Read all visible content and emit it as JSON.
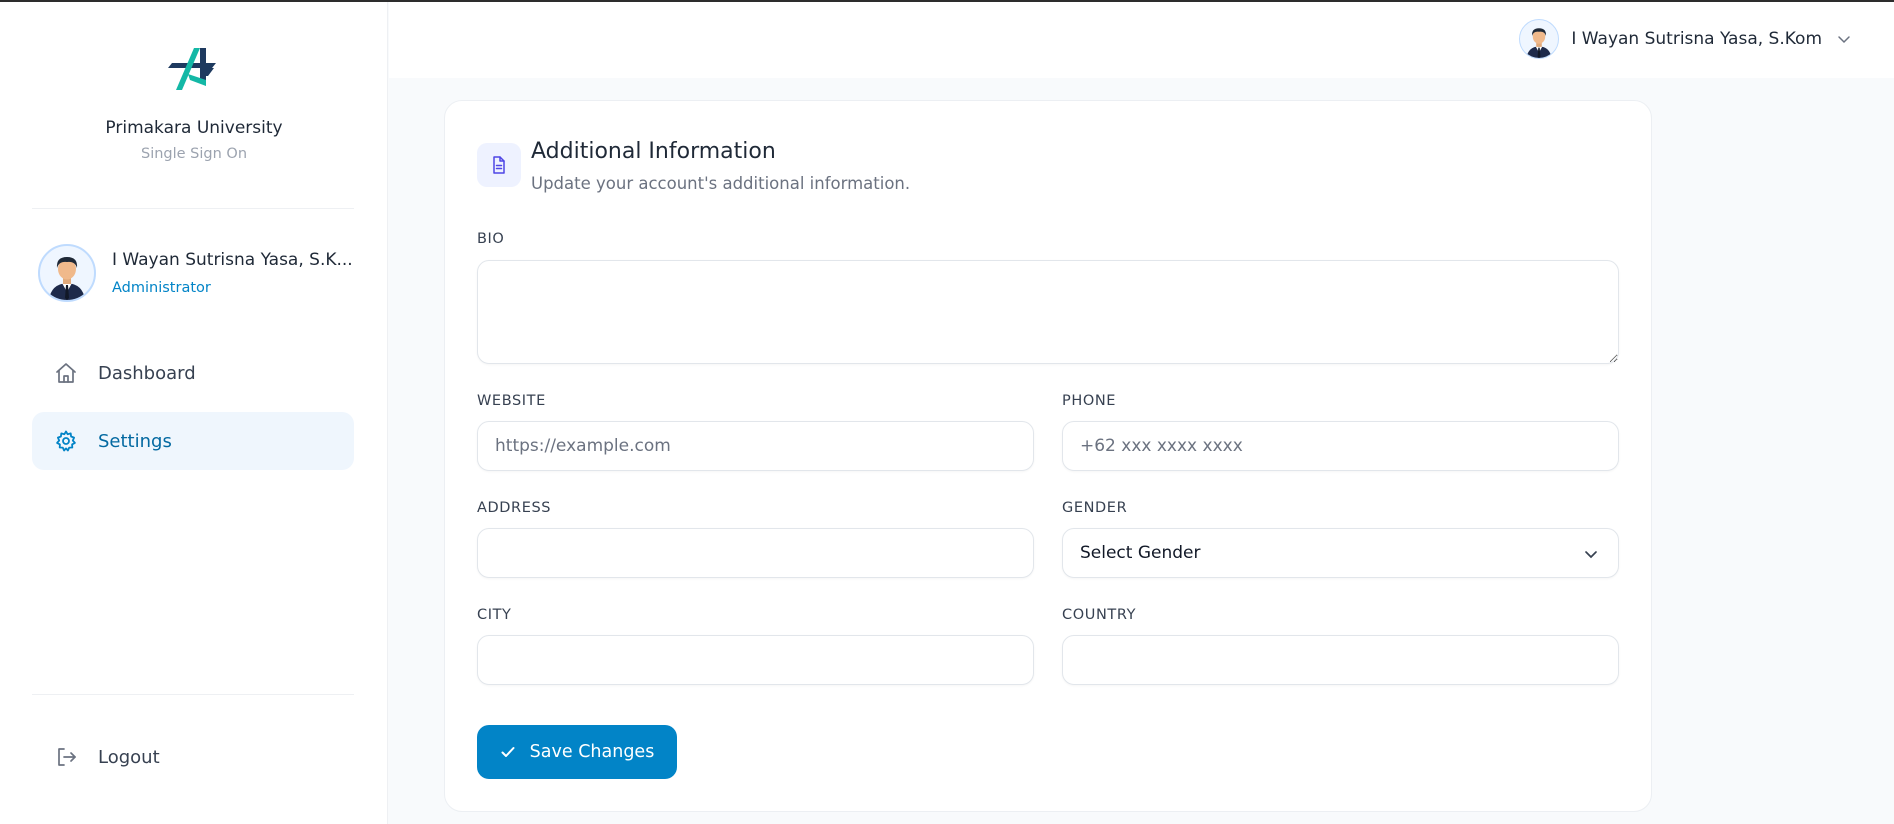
{
  "brand": {
    "name": "Primakara University",
    "subtitle": "Single Sign On"
  },
  "sidebar": {
    "user": {
      "name": "I Wayan Sutrisna Yasa, S.K...",
      "role": "Administrator"
    },
    "nav": [
      {
        "label": "Dashboard",
        "icon": "home-icon",
        "active": false
      },
      {
        "label": "Settings",
        "icon": "gear-icon",
        "active": true
      }
    ],
    "logout_label": "Logout"
  },
  "header": {
    "user_name": "I Wayan Sutrisna Yasa, S.Kom"
  },
  "form": {
    "title": "Additional Information",
    "subtitle": "Update your account's additional information.",
    "bio": {
      "label": "BIO",
      "value": "",
      "placeholder": ""
    },
    "website": {
      "label": "WEBSITE",
      "value": "",
      "placeholder": "https://example.com"
    },
    "phone": {
      "label": "PHONE",
      "value": "",
      "placeholder": "+62 xxx xxxx xxxx"
    },
    "address": {
      "label": "ADDRESS",
      "value": "",
      "placeholder": ""
    },
    "gender": {
      "label": "GENDER",
      "selected": "Select Gender"
    },
    "city": {
      "label": "CITY",
      "value": "",
      "placeholder": ""
    },
    "country": {
      "label": "COUNTRY",
      "value": "",
      "placeholder": ""
    },
    "save_label": "Save Changes"
  },
  "colors": {
    "accent": "#0284c7",
    "active_nav_bg": "#eff6fd",
    "logo_teal": "#14b8a6",
    "logo_navy": "#1e3a5f"
  }
}
